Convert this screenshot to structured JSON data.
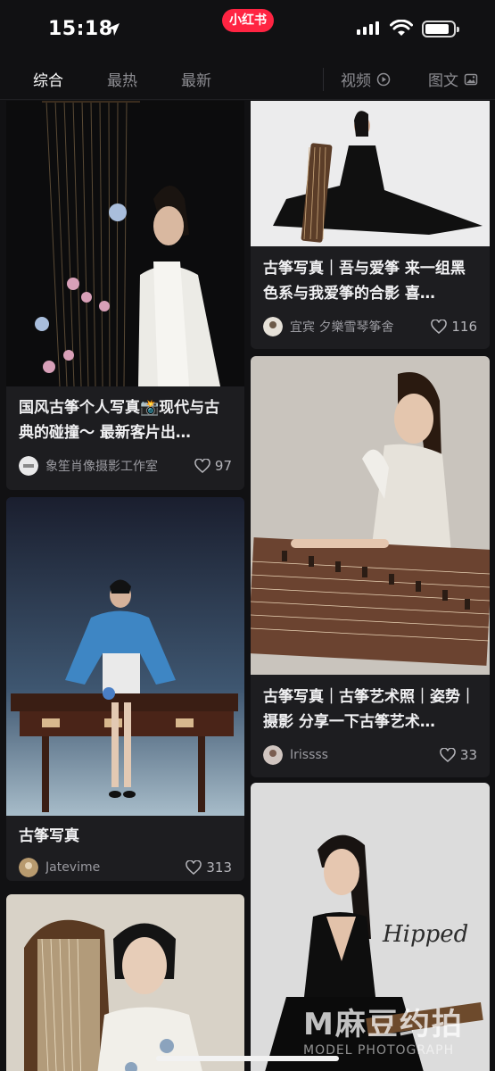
{
  "status": {
    "time": "15:18"
  },
  "app_badge": "小红书",
  "tabs": {
    "left": [
      {
        "label": "综合"
      },
      {
        "label": "最热"
      },
      {
        "label": "最新"
      }
    ],
    "video": "视频",
    "imagetext": "图文"
  },
  "cards": [
    {
      "title": "国风古筝个人写真📸现代与古典的碰撞～ 最新客片出…",
      "author": "象笙肖像摄影工作室",
      "likes": "97"
    },
    {
      "title": "古筝写真｜吾与爱筝 来一组黑色系与我爱筝的合影 喜…",
      "author": "宜宾 夕樂雪琴筝舍",
      "likes": "116"
    },
    {
      "title": "古筝写真",
      "author": "Jatevime",
      "likes": "313"
    },
    {
      "title": "古筝写真｜古筝艺术照｜姿势｜摄影 分享一下古筝艺术…",
      "author": "Irissss",
      "likes": "33"
    }
  ],
  "watermark": {
    "main": "M麻豆约拍",
    "sub": "MODEL PHOTOGRAPH"
  },
  "colors": {
    "accent": "#ff2442",
    "background": "#111113",
    "card": "#1d1d20"
  }
}
